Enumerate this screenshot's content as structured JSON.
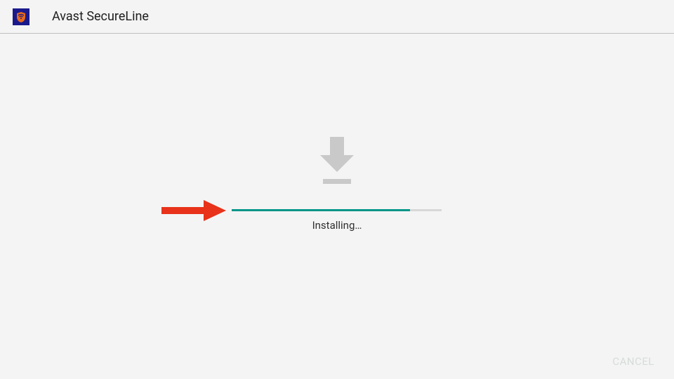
{
  "header": {
    "title": "Avast SecureLine"
  },
  "install": {
    "status_text": "Installing…",
    "progress_percent": 85
  },
  "actions": {
    "cancel_label": "CANCEL"
  },
  "colors": {
    "accent": "#009688",
    "icon_bg": "#1a1a8c",
    "icon_fg": "#e66a1a",
    "arrow": "#e8321a"
  }
}
